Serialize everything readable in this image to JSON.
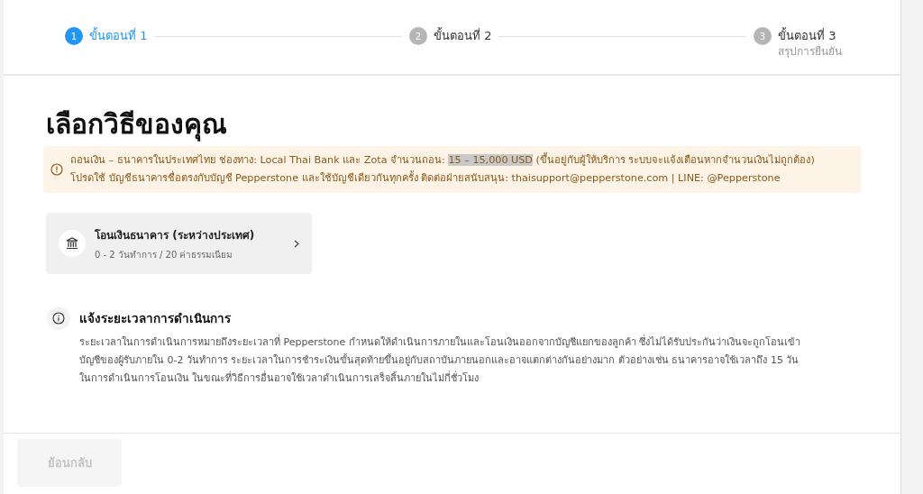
{
  "steps": [
    {
      "number": "1",
      "label": "ขั้นตอนที่ 1",
      "selected": true
    },
    {
      "number": "2",
      "label": "ขั้นตอนที่ 2",
      "selected": false
    },
    {
      "number": "3",
      "label": "ขั้นตอนที่ 3",
      "subtitle": "สรุปการยืนยัน",
      "selected": false
    }
  ],
  "title": "เลือกวิธีของคุณ",
  "notice": {
    "lines": [
      [
        {
          "text": "ถอนเงิน – ธนาคารในประเทศไทย ช่องทาง: Local Thai Bank และ Zota จำนวนถอน: ",
          "highlighted": false
        },
        {
          "text": "15 – 15,000 USD",
          "highlighted": true
        },
        {
          "text": " (ขึ้นอยู่กับผู้ให้บริการ ระบบจะแจ้งเตือนหากจำนวนเงินไม่ถูกต้อง)",
          "highlighted": false
        }
      ],
      [
        {
          "text": "โปรดใช้ บัญชีธนาคารชื่อตรงกับบัญชี Pepperstone และใช้บัญชีเดียวกันทุกครั้ง ติดต่อฝ่ายสนับสนุน: thaisupport@pepperstone.com | LINE: @Pepperstone",
          "highlighted": false
        }
      ]
    ]
  },
  "methods": [
    {
      "name": "โอนเงินธนาคาร (ระหว่างประเทศ)",
      "details": "0 - 2 วันทำการ / 20 ค่าธรรมเนียม"
    }
  ],
  "info": {
    "heading": "แจ้งระยะเวลาการดำเนินการ",
    "lines": [
      "ระยะเวลาในการดำเนินการหมายถึงระยะเวลาที่ Pepperstone กำหนดให้ดำเนินการภายในและโอนเงินออกจากบัญชีแยกของลูกค้า ซึ่งไม่ได้รับประกันว่าเงินจะถูกโอนเข้า",
      "บัญชีของผู้รับภายใน 0-2 วันทำการ ระยะเวลาในการชำระเงินขั้นสุดท้ายขึ้นอยู่กับสถาบันภายนอกและอาจแตกต่างกันอย่างมาก ตัวอย่างเช่น ธนาคารอาจใช้เวลาถึง 15 วัน",
      "ในการดำเนินการโอนเงิน ในขณะที่วิธีการอื่นอาจใช้เวลาดำเนินการเสร็จสิ้นภายในไม่กี่ชั่วโมง"
    ]
  },
  "back_button": {
    "label": "ย้อนกลับ",
    "disabled": true
  }
}
